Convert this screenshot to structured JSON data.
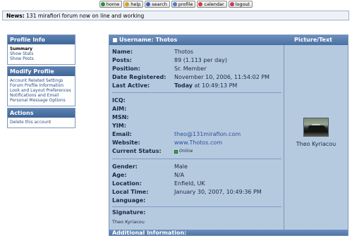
{
  "menu": [
    {
      "label": "home",
      "icon": "home-icon",
      "color": "#2b8f3a"
    },
    {
      "label": "help",
      "icon": "help-icon",
      "color": "#d4a019"
    },
    {
      "label": "search",
      "icon": "search-icon",
      "color": "#3566b5"
    },
    {
      "label": "profile",
      "icon": "profile-icon",
      "color": "#4b7fc4"
    },
    {
      "label": "calendar",
      "icon": "calendar-icon",
      "color": "#c94040"
    },
    {
      "label": "logout",
      "icon": "logout-icon",
      "color": "#c23b6e"
    }
  ],
  "news": {
    "label": "News:",
    "text": "131 mirafiori forum now on line and working"
  },
  "sidebar": {
    "profile_info": {
      "title": "Profile Info",
      "items": [
        "Summary",
        "Show Stats",
        "Show Posts"
      ]
    },
    "modify_profile": {
      "title": "Modify Profile",
      "items": [
        "Account Related Settings",
        "Forum Profile Information",
        "Look and Layout Preferences",
        "Notifications and Email",
        "Personal Message Options"
      ]
    },
    "actions": {
      "title": "Actions",
      "items": [
        "Delete this account"
      ]
    }
  },
  "profile": {
    "header_title": "Username: Thotos",
    "picture_title": "Picture/Text",
    "name": {
      "label": "Name:",
      "value": "Thotos"
    },
    "posts": {
      "label": "Posts:",
      "value": "89 (1.113 per day)"
    },
    "position": {
      "label": "Position:",
      "value": "Sr. Member"
    },
    "date_registered": {
      "label": "Date Registered:",
      "value": "November 10, 2006, 11:54:02 PM"
    },
    "last_active": {
      "label": "Last Active:",
      "value_bold": "Today",
      "value": " at 10:49:13 PM"
    },
    "icq": {
      "label": "ICQ:",
      "value": ""
    },
    "aim": {
      "label": "AIM:",
      "value": ""
    },
    "msn": {
      "label": "MSN:",
      "value": ""
    },
    "yim": {
      "label": "YIM:",
      "value": ""
    },
    "email": {
      "label": "Email:",
      "value": "theo@131mirafion.com"
    },
    "website": {
      "label": "Website:",
      "value": "www.Thotos.com"
    },
    "current_status": {
      "label": "Current Status:",
      "value": "Online"
    },
    "gender": {
      "label": "Gender:",
      "value": "Male"
    },
    "age": {
      "label": "Age:",
      "value": "N/A"
    },
    "location": {
      "label": "Location:",
      "value": "Enfield, UK"
    },
    "local_time": {
      "label": "Local Time:",
      "value": "January 30, 2007, 10:49:36 PM"
    },
    "language": {
      "label": "Language:",
      "value": ""
    },
    "signature": {
      "label": "Signature:",
      "value": "Theo Kyriacou"
    },
    "avatar_name": "Theo Kyriacou",
    "additional_info": "Additional Information:"
  },
  "colors": {
    "panel_bg": "#b6cadf",
    "header": "#4a70a2",
    "online": "#3da43d"
  }
}
